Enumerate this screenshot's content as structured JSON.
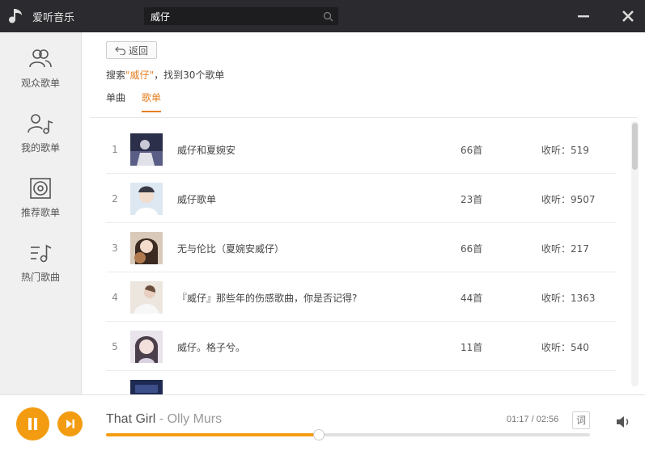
{
  "app": {
    "title": "爱听音乐"
  },
  "search": {
    "value": "威仔"
  },
  "sidebar": {
    "items": [
      {
        "label": "观众歌单",
        "icon": "users-icon"
      },
      {
        "label": "我的歌单",
        "icon": "user-music-icon"
      },
      {
        "label": "推荐歌单",
        "icon": "disc-icon"
      },
      {
        "label": "热门歌曲",
        "icon": "hot-music-icon"
      }
    ]
  },
  "main": {
    "back_label": "返回",
    "summary_prefix": "搜索",
    "summary_keyword": "\"威仔\"",
    "summary_suffix": "，找到30个歌单",
    "tabs": [
      {
        "label": "单曲",
        "active": false
      },
      {
        "label": "歌单",
        "active": true
      }
    ],
    "rows": [
      {
        "index": "1",
        "name": "威仔和夏婉安",
        "count": "66首",
        "listens": "收听：519"
      },
      {
        "index": "2",
        "name": "威仔歌单",
        "count": "23首",
        "listens": "收听：9507"
      },
      {
        "index": "3",
        "name": "无与伦比（夏婉安威仔）",
        "count": "66首",
        "listens": "收听：217"
      },
      {
        "index": "4",
        "name": "『威仔』那些年的伤感歌曲，你是否记得?",
        "count": "44首",
        "listens": "收听：1363"
      },
      {
        "index": "5",
        "name": "威仔。格子兮。",
        "count": "11首",
        "listens": "收听：540"
      }
    ]
  },
  "player": {
    "title": "That Girl",
    "separator": " - ",
    "artist": "Olly Murs",
    "time": "01:17 / 02:56",
    "lyric_label": "词",
    "progress": 0.44
  },
  "colors": {
    "accent": "#f39c12",
    "titlebar": "#2b2b2f"
  }
}
